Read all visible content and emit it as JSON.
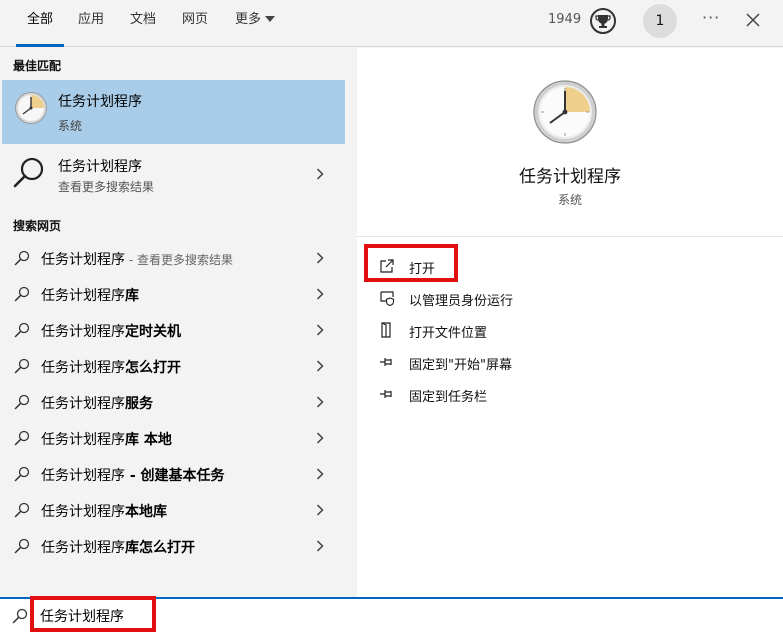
{
  "tabs": [
    {
      "label": "全部",
      "active": true
    },
    {
      "label": "应用"
    },
    {
      "label": "文档"
    },
    {
      "label": "网页"
    },
    {
      "label": "更多"
    }
  ],
  "header": {
    "points": "1949",
    "avatar_text": "1",
    "more_label": "···"
  },
  "left": {
    "best_match_label": "最佳匹配",
    "best_match": {
      "title": "任务计划程序",
      "subtitle": "系统"
    },
    "more_results": {
      "title": "任务计划程序",
      "subtitle": "查看更多搜索结果"
    },
    "web_label": "搜索网页",
    "web_rows": [
      {
        "prefix": "任务计划程序",
        "suffix": "",
        "sub": " - 查看更多搜索结果"
      },
      {
        "prefix": "任务计划程序",
        "suffix": "库",
        "sub": ""
      },
      {
        "prefix": "任务计划程序",
        "suffix": "定时关机",
        "sub": ""
      },
      {
        "prefix": "任务计划程序",
        "suffix": "怎么打开",
        "sub": ""
      },
      {
        "prefix": "任务计划程序",
        "suffix": "服务",
        "sub": ""
      },
      {
        "prefix": "任务计划程序",
        "suffix": "库 本地",
        "sub": ""
      },
      {
        "prefix": "任务计划程序",
        "suffix": " - 创建基本任务",
        "sub": ""
      },
      {
        "prefix": "任务计划程序",
        "suffix": "本地库",
        "sub": ""
      },
      {
        "prefix": "任务计划程序",
        "suffix": "库怎么打开",
        "sub": ""
      }
    ]
  },
  "right": {
    "title": "任务计划程序",
    "subtitle": "系统",
    "actions": [
      {
        "label": "打开",
        "icon": "open-icon"
      },
      {
        "label": "以管理员身份运行",
        "icon": "shield-icon"
      },
      {
        "label": "打开文件位置",
        "icon": "file-location-icon"
      },
      {
        "label": "固定到\"开始\"屏幕",
        "icon": "pin-icon"
      },
      {
        "label": "固定到任务栏",
        "icon": "pin-icon"
      }
    ]
  },
  "search": {
    "value": "任务计划程序"
  },
  "colors": {
    "accent": "#0067c0",
    "highlight": "#a9cde8",
    "annotation": "#e01010"
  }
}
